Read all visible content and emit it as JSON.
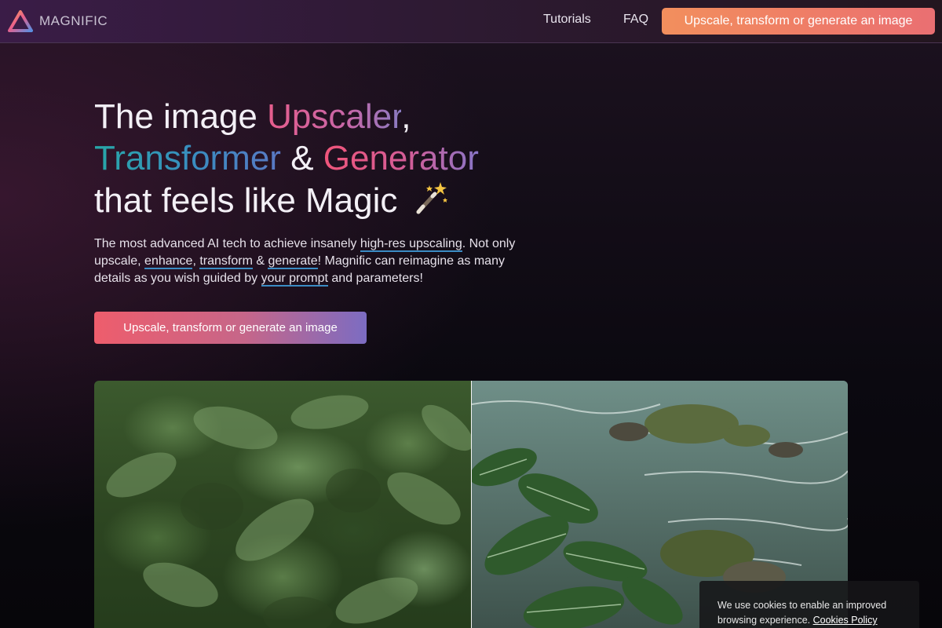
{
  "nav": {
    "brand": "MAGNIFIC",
    "links": [
      "Tutorials",
      "FAQ"
    ],
    "cta": "Upscale, transform or generate an image"
  },
  "hero": {
    "title_line1_a": "The image ",
    "title_line1_b": "Upscaler",
    "title_line1_c": ",",
    "title_line2_a": "Transformer",
    "title_line2_b": " & ",
    "title_line2_c": "Generator",
    "title_line3": "that feels like Magic",
    "wand_icon": "magic-wand-icon",
    "desc_1": "The most advanced AI tech to achieve insanely ",
    "link_upscaling": "high-res upscaling",
    "desc_2": ". Not only upscale, ",
    "link_enhance": "enhance",
    "desc_3": ", ",
    "link_transform": "transform",
    "desc_4": " & ",
    "link_generate": "generate",
    "desc_5": "! Magnific can reimagine as many details as you wish guided by ",
    "link_prompt": "your prompt",
    "desc_6": " and parameters!",
    "cta": "Upscale, transform or generate an image"
  },
  "cookie": {
    "text": "We use cookies to enable an improved browsing experience. ",
    "link": "Cookies Policy"
  },
  "colors": {
    "accent_orange": "#f28f5d",
    "accent_pink": "#ee5d6c",
    "accent_purple": "#7c6cc2",
    "accent_teal": "#27a7a8"
  }
}
